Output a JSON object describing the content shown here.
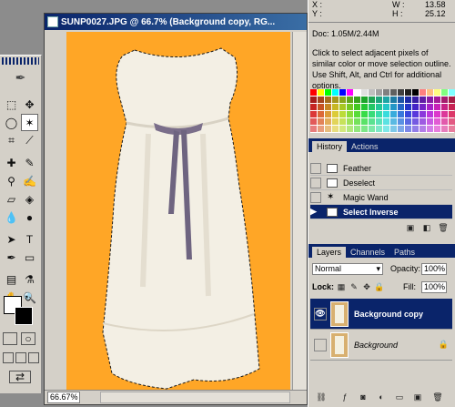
{
  "document": {
    "title": "SUNP0027.JPG @ 66.7% (Background copy, RG...",
    "zoom": "66.67%",
    "canvas_color": "#ffa626"
  },
  "info": {
    "x_label": "X :",
    "y_label": "Y :",
    "w_label": "W :",
    "h_label": "H :",
    "w_value": "13.58",
    "h_value": "25.12",
    "doc": "Doc: 1.05M/2.44M",
    "hint": "Click to select adjacent pixels of similar color or move selection outline.  Use Shift, Alt, and Ctrl for additional options."
  },
  "history": {
    "tabs": [
      "History",
      "Actions"
    ],
    "items": [
      "Feather",
      "Deselect",
      "Magic Wand",
      "Select Inverse"
    ]
  },
  "layers": {
    "tabs": [
      "Layers",
      "Channels",
      "Paths"
    ],
    "blend_mode": "Normal",
    "opacity_label": "Opacity:",
    "opacity_value": "100%",
    "lock_label": "Lock:",
    "fill_label": "Fill:",
    "fill_value": "100%",
    "items": [
      "Background copy",
      "Background"
    ]
  },
  "colors": {
    "accent": "#0a246a",
    "panel": "#d4d0c8"
  }
}
